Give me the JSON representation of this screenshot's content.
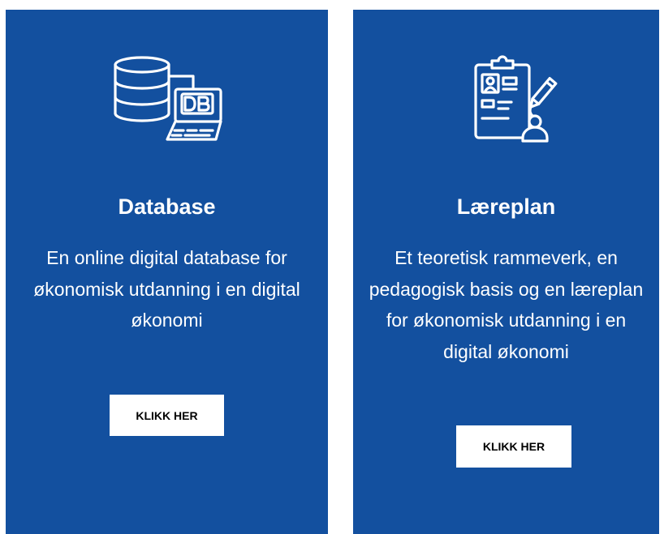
{
  "theme": {
    "background": "#ffffff",
    "card_color": "#13509f",
    "text_color": "#ffffff",
    "button_color": "#ffffff",
    "button_text_color": "#000000"
  },
  "cards": [
    {
      "icon": "database-laptop-icon",
      "title": "Database",
      "description_lines": [
        "En online digital database for",
        "økonomisk utdanning i en digital",
        "økonomi"
      ],
      "button_label": "KLIKK HER"
    },
    {
      "icon": "curriculum-clipboard-icon",
      "title": "Læreplan",
      "description_lines": [
        "Et teoretisk rammeverk, en",
        "pedagogisk basis og en læreplan",
        "for økonomisk utdanning i en",
        "digital økonomi"
      ],
      "button_label": "KLIKK HER"
    }
  ]
}
